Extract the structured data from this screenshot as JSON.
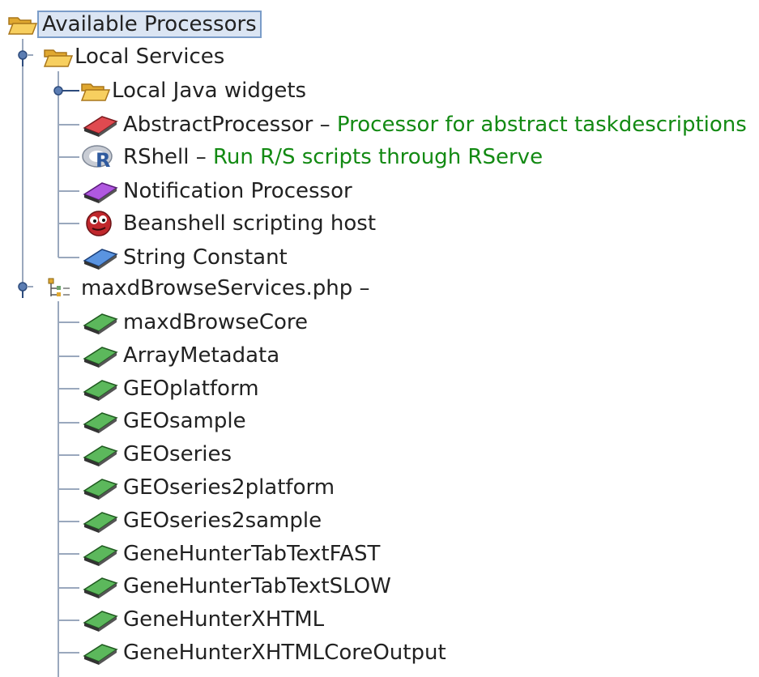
{
  "tree": {
    "root": {
      "label": "Available Processors",
      "icon": "folder-open-icon"
    },
    "local_services": {
      "label": "Local Services",
      "icon": "folder-open-icon",
      "children": {
        "java_widgets": {
          "label": "Local Java widgets",
          "icon": "folder-open-icon"
        },
        "items": [
          {
            "label": "AbstractProcessor",
            "separator": " – ",
            "description": "Processor for abstract taskdescriptions",
            "icon": "red-processor-icon",
            "icon_color": "#d9393e"
          },
          {
            "label": "RShell",
            "separator": " – ",
            "description": "Run R/S scripts through RServe",
            "icon": "r-logo-icon",
            "icon_color": "#3a5fa0"
          },
          {
            "label": "Notification Processor",
            "separator": "",
            "description": "",
            "icon": "purple-processor-icon",
            "icon_color": "#a347d6"
          },
          {
            "label": "Beanshell scripting host",
            "separator": "",
            "description": "",
            "icon": "beanshell-icon",
            "icon_color": "#b3262a"
          },
          {
            "label": "String Constant",
            "separator": "",
            "description": "",
            "icon": "blue-processor-icon",
            "icon_color": "#4a86d6"
          }
        ]
      }
    },
    "maxd": {
      "label": "maxdBrowseServices.php –",
      "icon": "wsdl-tree-icon",
      "items": [
        {
          "label": "maxdBrowseCore"
        },
        {
          "label": "ArrayMetadata"
        },
        {
          "label": "GEOplatform"
        },
        {
          "label": "GEOsample"
        },
        {
          "label": "GEOseries"
        },
        {
          "label": "GEOseries2platform"
        },
        {
          "label": "GEOseries2sample"
        },
        {
          "label": "GeneHunterTabTextFAST"
        },
        {
          "label": "GeneHunterTabTextSLOW"
        },
        {
          "label": "GeneHunterXHTML"
        },
        {
          "label": "GeneHunterXHTMLCoreOutput"
        }
      ],
      "item_icon": "green-processor-icon",
      "item_icon_color": "#4fae4f"
    },
    "colors": {
      "description": "#138a13",
      "selection_bg": "#dbe5f3",
      "selection_border": "#7a9cc8",
      "tree_line": "#9aa8bd",
      "folder": "#f2c14a"
    }
  }
}
